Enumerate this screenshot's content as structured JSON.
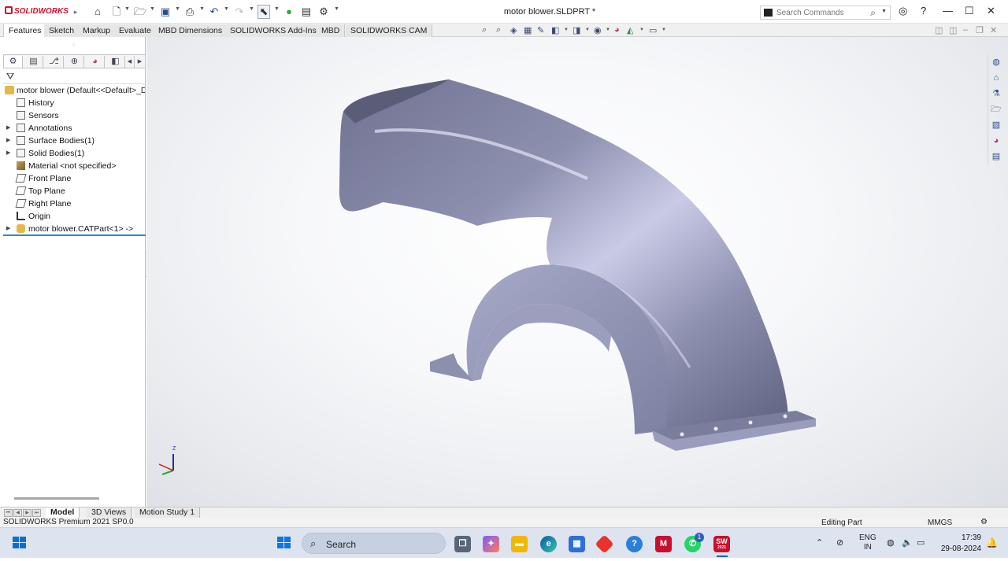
{
  "app": {
    "brand": "SOLIDWORKS",
    "document_title": "motor blower.SLDPRT *",
    "search_placeholder": "Search Commands"
  },
  "command_tabs": [
    "Features",
    "Sketch",
    "Markup",
    "Evaluate",
    "MBD Dimensions",
    "SOLIDWORKS Add-Ins",
    "MBD",
    "SOLIDWORKS CAM"
  ],
  "active_command_tab": "Features",
  "feature_tree": {
    "root": "motor blower  (Default<<Default>_D",
    "items": [
      {
        "label": "History",
        "expandable": false
      },
      {
        "label": "Sensors",
        "expandable": false
      },
      {
        "label": "Annotations",
        "expandable": true
      },
      {
        "label": "Surface Bodies(1)",
        "expandable": true
      },
      {
        "label": "Solid Bodies(1)",
        "expandable": true
      },
      {
        "label": "Material <not specified>",
        "expandable": false
      },
      {
        "label": "Front Plane",
        "expandable": false
      },
      {
        "label": "Top Plane",
        "expandable": false
      },
      {
        "label": "Right Plane",
        "expandable": false
      },
      {
        "label": "Origin",
        "expandable": false
      },
      {
        "label": "motor blower.CATPart<1> ->",
        "expandable": true
      }
    ]
  },
  "bottom_tabs": [
    "Model",
    "3D Views",
    "Motion Study 1"
  ],
  "active_bottom_tab": "Model",
  "statusbar": {
    "left": "SOLIDWORKS Premium 2021 SP0.0",
    "mode": "Editing Part",
    "units": "MMGS"
  },
  "triad": {
    "z": "Z"
  },
  "taskbar": {
    "search_label": "Search",
    "lang_1": "ENG",
    "lang_2": "IN",
    "time": "17:39",
    "date": "29-08-2024",
    "whatsapp_badge": "1",
    "sw_label": "SW",
    "sw_year": "2021"
  },
  "colors": {
    "accent": "#d0102b",
    "model_light": "#a9abc8",
    "model_dark": "#555873",
    "taskbar_bg": "#dde4f0"
  }
}
